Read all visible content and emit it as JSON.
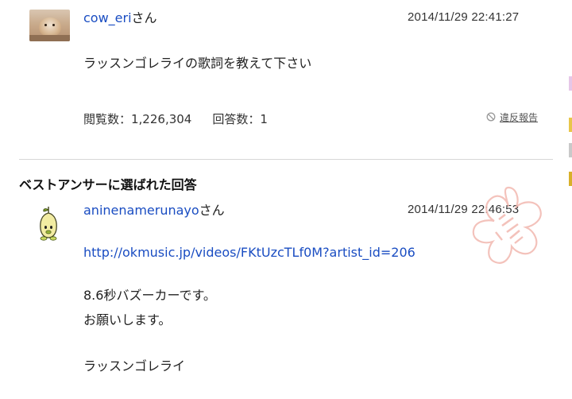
{
  "question": {
    "username": "cow_eri",
    "honorific": "さん",
    "timestamp": "2014/11/29  22:41:27",
    "text": "ラッスンゴレライの歌詞を教えて下さい",
    "views_label": "閲覧数：1,226,304",
    "answers_label": "回答数：1",
    "report_label": "違反報告"
  },
  "best_answer": {
    "heading": "ベストアンサーに選ばれた回答",
    "username": "aninenamerunayo",
    "honorific": "さん",
    "timestamp": "2014/11/29  22:46:53",
    "link": "http://okmusic.jp/videos/FKtUzcTLf0M?artist_id=206",
    "lines": [
      "8.6秒バズーカーです。",
      "お願いします。",
      "ラッスンゴレライ"
    ]
  },
  "colors": {
    "link": "#1a4dc2",
    "divider": "#d6d6d6",
    "stamp": "#f2b8b0"
  },
  "icons": {
    "report": "prohibited-icon",
    "stamp": "flower-stamp-icon",
    "answer_avatar": "seedling-character-icon"
  }
}
